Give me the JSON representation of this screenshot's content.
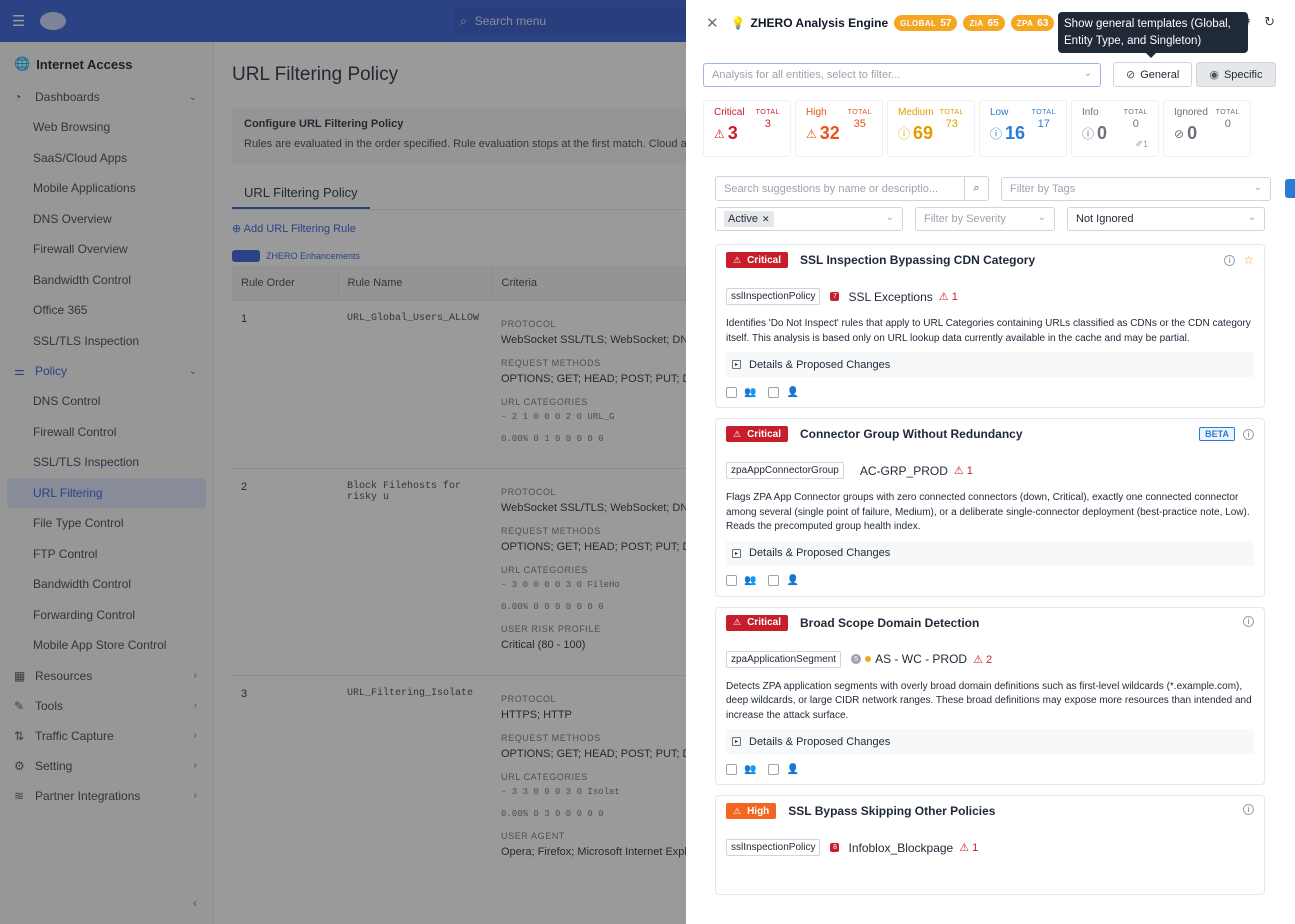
{
  "topbar": {
    "search_placeholder": "Search menu"
  },
  "sidebar": {
    "section": "Internet Access",
    "dashboards": {
      "label": "Dashboards",
      "items": [
        "Web Browsing",
        "SaaS/Cloud Apps",
        "Mobile Applications",
        "DNS Overview",
        "Firewall Overview",
        "Bandwidth Control",
        "Office 365",
        "SSL/TLS Inspection"
      ]
    },
    "policy": {
      "label": "Policy",
      "items": [
        "DNS Control",
        "Firewall Control",
        "SSL/TLS Inspection",
        "URL Filtering",
        "File Type Control",
        "FTP Control",
        "Bandwidth Control",
        "Forwarding Control",
        "Mobile App Store Control"
      ]
    },
    "groups": [
      "Resources",
      "Tools",
      "Traffic Capture",
      "Setting",
      "Partner Integrations"
    ]
  },
  "main": {
    "title": "URL Filtering Policy",
    "config_title": "Configure URL Filtering Policy",
    "config_desc": "Rules are evaluated in the order specified. Rule evaluation stops at the first match. Cloud app c",
    "tab": "URL Filtering Policy",
    "add_rule": "Add URL Filtering Rule",
    "zhero_toggle": "ZHERO Enhancements",
    "columns": {
      "order": "Rule Order",
      "name": "Rule Name",
      "criteria": "Criteria"
    },
    "rows": [
      {
        "order": "1",
        "name": "URL_Global_Users_ALLOW",
        "protocol_label": "PROTOCOL",
        "protocol": "WebSocket SSL/TLS; WebSocket; DNS",
        "methods_label": "REQUEST METHODS",
        "methods": "OPTIONS; GET; HEAD; POST; PUT; DEL",
        "cats_label": "URL CATEGORIES",
        "cats1": "- 2 1 0 0 0 2 0 URL_G",
        "cats2": "0.00% 0 1 0 0 0 0 0"
      },
      {
        "order": "2",
        "name": "Block Filehosts for risky u",
        "protocol_label": "PROTOCOL",
        "protocol": "WebSocket SSL/TLS; WebSocket; DNS",
        "methods_label": "REQUEST METHODS",
        "methods": "OPTIONS; GET; HEAD; POST; PUT; DEL",
        "cats_label": "URL CATEGORIES",
        "cats1": "- 3 0 0 0 0 3 0 FileHo",
        "cats2": "0.00% 0 0 0 0 0 0 0",
        "risk_label": "USER RISK PROFILE",
        "risk": "Critical (80 - 100)"
      },
      {
        "order": "3",
        "name": "URL_Filtering_Isolate",
        "protocol_label": "PROTOCOL",
        "protocol": "HTTPS; HTTP",
        "methods_label": "REQUEST METHODS",
        "methods": "OPTIONS; GET; HEAD; POST; PUT; DEL",
        "cats_label": "URL CATEGORIES",
        "cats1": "- 3 3 0 0 0 3 0 Isolat",
        "cats2": "0.00% 0 3 0 0 0 0 0",
        "agent_label": "USER AGENT",
        "agent": "Opera; Firefox; Microsoft Internet Explo"
      }
    ]
  },
  "panel": {
    "title": "ZHERO Analysis Engine",
    "pills": [
      {
        "label": "GLOBAL",
        "value": "57"
      },
      {
        "label": "ZIA",
        "value": "65"
      },
      {
        "label": "ZPA",
        "value": "63"
      }
    ],
    "tooltip": "Show general templates (Global, Entity Type, and Singleton)",
    "entity_placeholder": "Analysis for all entities, select to filter...",
    "general_btn": "General",
    "specific_btn": "Specific",
    "stats": [
      {
        "label": "Critical",
        "value": "3",
        "total_label": "TOTAL",
        "total": "3",
        "color": "#c81e2b"
      },
      {
        "label": "High",
        "value": "32",
        "total_label": "TOTAL",
        "total": "35",
        "color": "#e8541c"
      },
      {
        "label": "Medium",
        "value": "69",
        "total_label": "TOTAL",
        "total": "73",
        "color": "#e39b00"
      },
      {
        "label": "Low",
        "value": "16",
        "total_label": "TOTAL",
        "total": "17",
        "color": "#2a7bd8"
      },
      {
        "label": "Info",
        "value": "0",
        "total_label": "TOTAL",
        "total": "0",
        "sub": "1",
        "color": "#6b7280"
      },
      {
        "label": "Ignored",
        "value": "0",
        "total_label": "TOTAL",
        "total": "0",
        "color": "#6b7280"
      }
    ],
    "search_placeholder": "Search suggestions by name or descriptio...",
    "tags_placeholder": "Filter by Tags",
    "status_chip": "Active",
    "severity_placeholder": "Filter by Severity",
    "ignored_value": "Not Ignored",
    "cards": [
      {
        "severity": "Critical",
        "title": "SSL Inspection Bypassing CDN Category",
        "entity_type": "sslInspectionPolicy",
        "entity_icon": "7",
        "entity": "SSL Exceptions",
        "count": "1",
        "desc": "Identifies 'Do Not Inspect' rules that apply to URL Categories containing URLs classified as CDNs or the CDN category itself. This analysis is based only on URL lookup data currently available in the cache and may be partial.",
        "details": "Details & Proposed Changes"
      },
      {
        "severity": "Critical",
        "title": "Connector Group Without Redundancy",
        "badge": "BETA",
        "entity_type": "zpaAppConnectorGroup",
        "entity": "AC-GRP_PROD",
        "count": "1",
        "desc": "Flags ZPA App Connector groups with zero connected connectors (down, Critical), exactly one connected connector among several (single point of failure, Medium), or a deliberate single-connector deployment (best-practice note, Low). Reads the precomputed group health index.",
        "details": "Details & Proposed Changes"
      },
      {
        "severity": "Critical",
        "title": "Broad Scope Domain Detection",
        "entity_type": "zpaApplicationSegment",
        "entity_icon": "5",
        "entity": "AS - WC - PROD",
        "count": "2",
        "desc": "Detects ZPA application segments with overly broad domain definitions such as first-level wildcards (*.example.com), deep wildcards, or large CIDR network ranges. These broad definitions may expose more resources than intended and increase the attack surface.",
        "details": "Details & Proposed Changes"
      },
      {
        "severity": "High",
        "title": "SSL Bypass Skipping Other Policies",
        "entity_type": "sslInspectionPolicy",
        "entity_icon": "8",
        "entity": "Infoblox_Blockpage",
        "count": "1"
      }
    ]
  }
}
